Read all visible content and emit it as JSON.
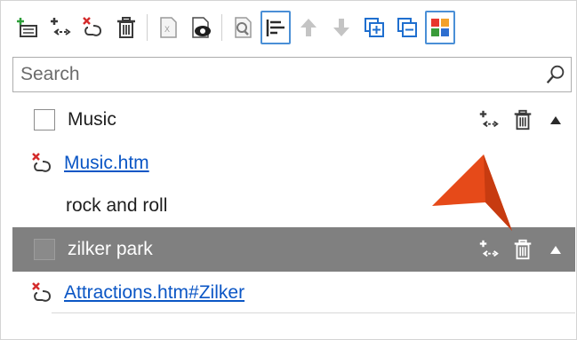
{
  "toolbar": {
    "buttons": [
      {
        "icon": "add-term-icon"
      },
      {
        "icon": "add-link-icon"
      },
      {
        "icon": "remove-link-icon"
      },
      {
        "icon": "delete-icon"
      },
      {
        "icon": "export-icon"
      },
      {
        "icon": "preview-icon"
      },
      {
        "icon": "search-document-icon"
      },
      {
        "icon": "sort-icon",
        "selected": true
      },
      {
        "icon": "move-up-icon"
      },
      {
        "icon": "move-down-icon"
      },
      {
        "icon": "expand-all-icon"
      },
      {
        "icon": "collapse-all-icon"
      },
      {
        "icon": "color-palette-icon"
      }
    ]
  },
  "search": {
    "placeholder": "Search",
    "value": ""
  },
  "tree": {
    "term1": {
      "label": "Music",
      "checked": false
    },
    "link1": {
      "label": "Music.htm"
    },
    "subterm": {
      "label": "rock and roll"
    },
    "term2": {
      "label": "zilker park",
      "selected": true,
      "checked": false
    },
    "link2": {
      "label": "Attractions.htm#Zilker"
    }
  },
  "colors": {
    "accent": "#4a8fd6",
    "link": "#0b56c5",
    "selected_row": "#808080",
    "callout": "#e64a19"
  }
}
